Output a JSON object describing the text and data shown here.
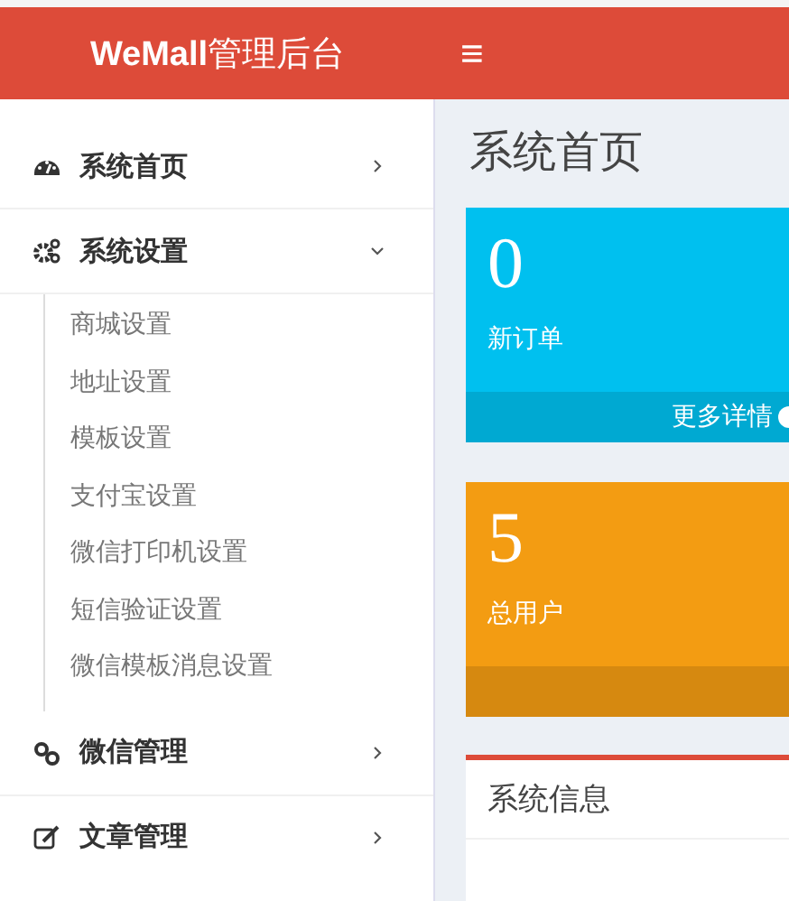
{
  "header": {
    "logo_bold": "WeMall",
    "logo_rest": "管理后台",
    "menu_toggle": "≡"
  },
  "sidebar": {
    "items": [
      {
        "label": "系统首页",
        "expanded": false
      },
      {
        "label": "系统设置",
        "expanded": true,
        "children": [
          {
            "label": "商城设置"
          },
          {
            "label": "地址设置"
          },
          {
            "label": "模板设置"
          },
          {
            "label": "支付宝设置"
          },
          {
            "label": "微信打印机设置"
          },
          {
            "label": "短信验证设置"
          },
          {
            "label": "微信模板消息设置"
          }
        ]
      },
      {
        "label": "微信管理",
        "expanded": false
      },
      {
        "label": "文章管理",
        "expanded": false
      }
    ]
  },
  "main": {
    "title": "系统首页",
    "stat_cards": [
      {
        "value": "0",
        "label": "新订单",
        "color": "#00c0ef",
        "footer_link": "更多详情"
      },
      {
        "value": "5",
        "label": "总用户",
        "color": "#f39c12"
      }
    ],
    "info_box": {
      "title": "系统信息"
    }
  }
}
